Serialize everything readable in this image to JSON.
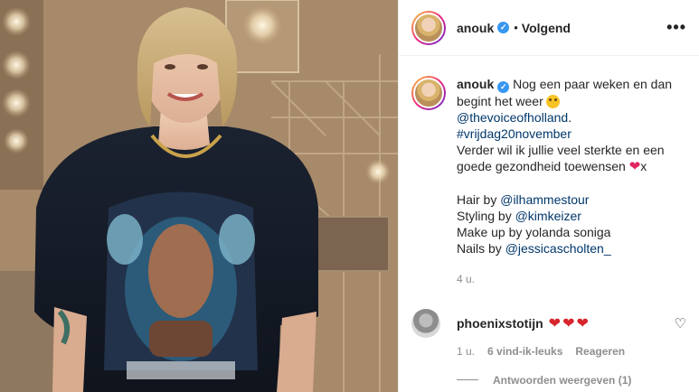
{
  "header": {
    "username": "anouk",
    "separator": "•",
    "follow_status": "Volgend",
    "more_icon": "more-icon"
  },
  "caption": {
    "username": "anouk",
    "text_1": "Nog een paar weken en dan begint het weer",
    "mention_1": "@thevoiceofholland",
    "mention_1_suffix": ".",
    "hashtag": "#vrijdag20november",
    "text_2": "Verder wil ik jullie veel sterkte en een goede gezondheid toewensen",
    "text_2_suffix": "x",
    "hair_label": "Hair by ",
    "hair_mention": "@ilhammestour",
    "styling_label": "Styling by ",
    "styling_mention": "@kimkeizer",
    "makeup_line": "Make up by yolanda soniga",
    "nails_label": "Nails by ",
    "nails_mention": "@jessicascholten_",
    "age": "4 u."
  },
  "comment": {
    "username": "phoenixstotijn",
    "hearts": "❤❤❤",
    "age": "1 u.",
    "likes": "6 vind-ik-leuks",
    "reply": "Reageren",
    "view_replies": "Antwoorden weergeven (1)"
  },
  "colors": {
    "verified": "#3897f0",
    "link": "#00376b",
    "heart": "#e0245e",
    "muted": "#8e8e8e"
  }
}
